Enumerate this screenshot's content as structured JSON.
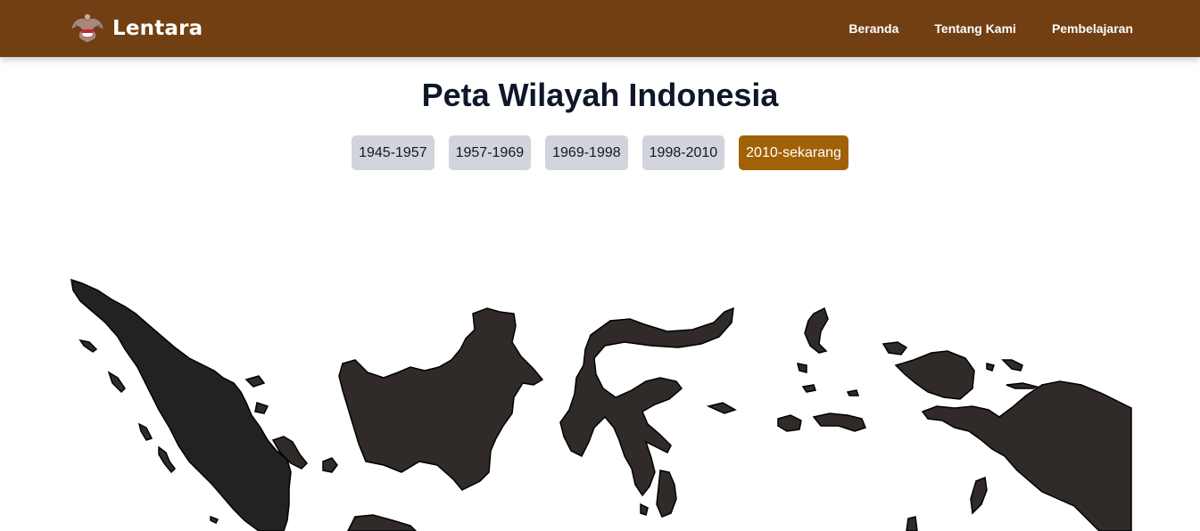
{
  "brand": {
    "name": "Lentara",
    "logo_icon": "garuda-emblem-icon"
  },
  "nav": {
    "items": [
      {
        "label": "Beranda"
      },
      {
        "label": "Tentang Kami"
      },
      {
        "label": "Pembelajaran"
      }
    ]
  },
  "page": {
    "title": "Peta Wilayah Indonesia"
  },
  "periods": {
    "items": [
      {
        "label": "1945-1957"
      },
      {
        "label": "1957-1969"
      },
      {
        "label": "1969-1998"
      },
      {
        "label": "1998-2010"
      },
      {
        "label": "2010-sekarang"
      }
    ],
    "selected": "2010-sekarang"
  },
  "colors": {
    "navbar": "#713f12",
    "active_tab": "#a16207",
    "inactive_tab": "#d1d5db",
    "map_fill": "#302a29"
  }
}
